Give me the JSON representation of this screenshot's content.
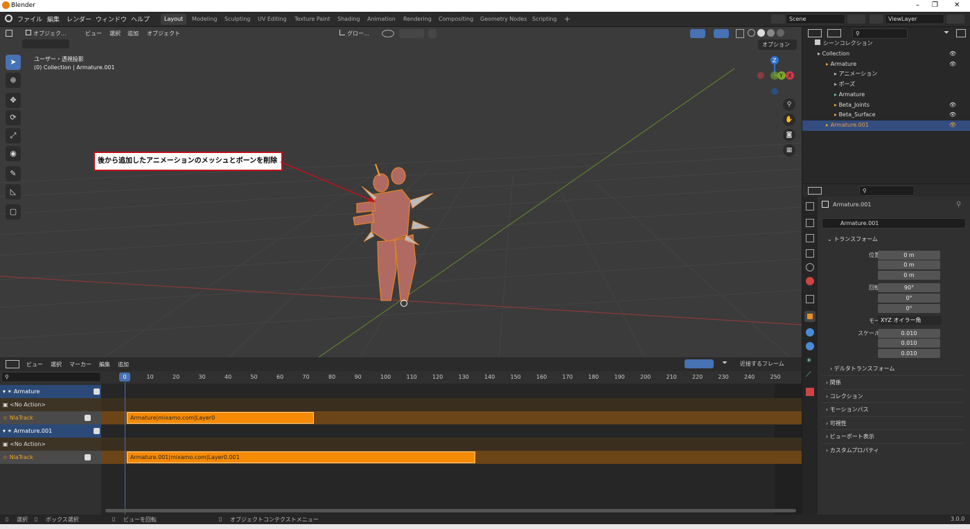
{
  "window": {
    "title": "Blender",
    "min": "–",
    "restore": "❐",
    "close": "✕"
  },
  "menus": [
    "ファイル",
    "編集",
    "レンダー",
    "ウィンドウ",
    "ヘルプ"
  ],
  "workspace_tabs": [
    {
      "label": "Layout",
      "active": true
    },
    {
      "label": "Modeling",
      "active": false
    },
    {
      "label": "Sculpting",
      "active": false
    },
    {
      "label": "UV Editing",
      "active": false
    },
    {
      "label": "Texture Paint",
      "active": false
    },
    {
      "label": "Shading",
      "active": false
    },
    {
      "label": "Animation",
      "active": false
    },
    {
      "label": "Rendering",
      "active": false
    },
    {
      "label": "Compositing",
      "active": false
    },
    {
      "label": "Geometry Nodes",
      "active": false
    },
    {
      "label": "Scripting",
      "active": false
    }
  ],
  "add_tab": "+",
  "scene": {
    "label": "Scene",
    "view_layer": "ViewLayer"
  },
  "viewport": {
    "mode": "オブジェク...",
    "menu": [
      "ビュー",
      "選択",
      "追加",
      "オブジェクト"
    ],
    "transform_orientation": "グロー...",
    "options": "オプション",
    "view_name": "ユーザー・透視投影",
    "collection_info": "(0) Collection | Armature.001",
    "annotation": "後から追加したアニメーションのメッシュとボーンを削除",
    "gizmo_z": "Z",
    "gizmo_y": "Y",
    "gizmo_x": "X"
  },
  "nla": {
    "menu": [
      "ビュー",
      "選択",
      "マーカー",
      "編集",
      "追加"
    ],
    "snap": "近接するフレーム",
    "current_frame": "0",
    "ruler": [
      "10",
      "20",
      "30",
      "40",
      "50",
      "60",
      "70",
      "80",
      "90",
      "100",
      "110",
      "120",
      "130",
      "140",
      "150",
      "160",
      "170",
      "180",
      "190",
      "200",
      "210",
      "220",
      "230",
      "240",
      "250"
    ],
    "channels": [
      {
        "kind": "object",
        "label": "Armature"
      },
      {
        "kind": "action",
        "label": "<No Action>"
      },
      {
        "kind": "track",
        "label": "NlaTrack"
      },
      {
        "kind": "object",
        "label": "Armature.001"
      },
      {
        "kind": "action",
        "label": "<No Action>"
      },
      {
        "kind": "track",
        "label": "NlaTrack"
      }
    ],
    "strips": [
      {
        "label": "Armature|mixamo.com|Layer0",
        "start": 1,
        "end": 73
      },
      {
        "label": "Armature.001|mixamo.com|Layer0.001",
        "start": 1,
        "end": 135
      }
    ]
  },
  "outliner": {
    "root": "シーンコレクション",
    "rows": [
      {
        "label": "Collection",
        "depth": 1,
        "color": "#cfcfcf"
      },
      {
        "label": "Armature",
        "depth": 2,
        "color": "#e8a040"
      },
      {
        "label": "アニメーション",
        "depth": 3,
        "color": "#bbbbbb"
      },
      {
        "label": "ポーズ",
        "depth": 3,
        "color": "#bbbbbb"
      },
      {
        "label": "Armature",
        "depth": 3,
        "color": "#67c79a"
      },
      {
        "label": "Beta_Joints",
        "depth": 3,
        "color": "#e8a040"
      },
      {
        "label": "Beta_Surface",
        "depth": 3,
        "color": "#e8a040"
      },
      {
        "label": "Armature.001",
        "depth": 2,
        "color": "#e8a040",
        "selected": true
      }
    ]
  },
  "properties": {
    "object_name": "Armature.001",
    "object_field": "Armature.001",
    "transform_header": "トランスフォーム",
    "location": {
      "label": "位置 X",
      "x": "0 m",
      "y": "0 m",
      "z": "0 m"
    },
    "rotation": {
      "label": "回転 X",
      "x": "90°",
      "y": "0°",
      "z": "0°"
    },
    "mode": {
      "label": "モード",
      "value": "XYZ オイラー角"
    },
    "scale": {
      "label": "スケール X",
      "x": "0.010",
      "y": "0.010",
      "z": "0.010"
    },
    "axis_y": "Y",
    "axis_z": "Z",
    "delta": "デルタトランスフォーム",
    "panels": [
      "関係",
      "コレクション",
      "モーションパス",
      "可視性",
      "ビューポート表示",
      "カスタムプロパティ"
    ]
  },
  "status": {
    "select": "選択",
    "box": "ボックス選択",
    "rotate": "ビューを回転",
    "context": "オブジェクトコンテクストメニュー",
    "version": "3.0.0"
  }
}
